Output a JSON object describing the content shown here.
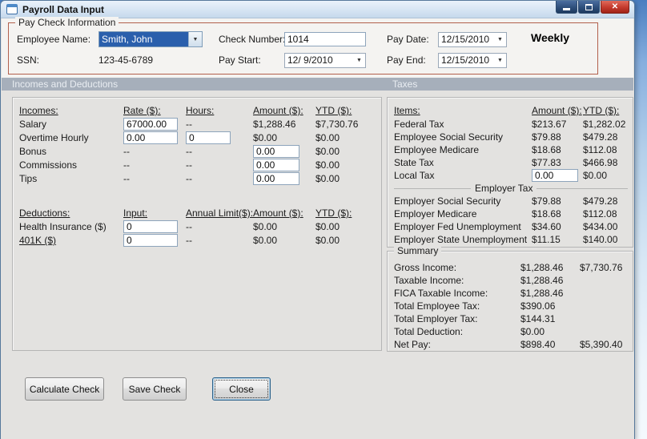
{
  "window": {
    "title": "Payroll Data Input"
  },
  "icons": {
    "close_glyph": "✕",
    "dropdown_glyph": "▼"
  },
  "colors": {
    "group_border": "#b2604d",
    "band_bg": "#a6afbb",
    "selection_bg": "#2a5fac",
    "close_button": "#c43a2d"
  },
  "paycheck": {
    "group_label": "Pay Check Information",
    "employee_name_label": "Employee Name:",
    "employee_name_value": "Smith, John",
    "ssn_label": "SSN:",
    "ssn_value": "123-45-6789",
    "check_number_label": "Check Number:",
    "check_number_value": "1014",
    "pay_start_label": "Pay Start:",
    "pay_start_value": "12/ 9/2010",
    "pay_date_label": "Pay Date:",
    "pay_date_value": "12/15/2010",
    "pay_end_label": "Pay End:",
    "pay_end_value": "12/15/2010",
    "frequency": "Weekly"
  },
  "sections": {
    "left": "Incomes and Deductions",
    "right": "Taxes"
  },
  "incomes": {
    "headers": {
      "c1": "Incomes:",
      "c2": "Rate ($):",
      "c3": "Hours:",
      "c4": "Amount ($):",
      "c5": "YTD ($):"
    },
    "rows": [
      {
        "label": "Salary",
        "rate": "67000.00",
        "hours": "--",
        "amount": "$1,288.46",
        "ytd": "$7,730.76"
      },
      {
        "label": "Overtime Hourly",
        "rate": "0.00",
        "hours": "0",
        "amount": "$0.00",
        "ytd": "$0.00"
      },
      {
        "label": "Bonus",
        "rate": "--",
        "hours": "--",
        "amount": "0.00",
        "ytd": "$0.00"
      },
      {
        "label": "Commissions",
        "rate": "--",
        "hours": "--",
        "amount": "0.00",
        "ytd": "$0.00"
      },
      {
        "label": "Tips",
        "rate": "--",
        "hours": "--",
        "amount": "0.00",
        "ytd": "$0.00"
      }
    ]
  },
  "deductions": {
    "headers": {
      "c1": "Deductions:",
      "c2": "Input:",
      "c3": "Annual Limit($):",
      "c4": "Amount ($):",
      "c5": "YTD ($):"
    },
    "rows": [
      {
        "label": "Health Insurance ($)",
        "input": "0",
        "limit": "--",
        "amount": "$0.00",
        "ytd": "$0.00"
      },
      {
        "label": "401K ($)",
        "input": "0",
        "limit": "--",
        "amount": "$0.00",
        "ytd": "$0.00"
      }
    ]
  },
  "taxes": {
    "headers": {
      "items": "Items:",
      "amount": "Amount ($):",
      "ytd": "YTD ($):"
    },
    "employee_rows": [
      {
        "label": "Federal Tax",
        "amount": "$213.67",
        "ytd": "$1,282.02"
      },
      {
        "label": "Employee Social Security",
        "amount": "$79.88",
        "ytd": "$479.28"
      },
      {
        "label": "Employee Medicare",
        "amount": "$18.68",
        "ytd": "$112.08"
      },
      {
        "label": "State Tax",
        "amount": "$77.83",
        "ytd": "$466.98"
      },
      {
        "label": "Local Tax",
        "amount": "0.00",
        "ytd": "$0.00"
      }
    ],
    "employer_header": "Employer Tax",
    "employer_rows": [
      {
        "label": "Employer Social Security",
        "amount": "$79.88",
        "ytd": "$479.28"
      },
      {
        "label": "Employer Medicare",
        "amount": "$18.68",
        "ytd": "$112.08"
      },
      {
        "label": "Employer Fed Unemployment",
        "amount": "$34.60",
        "ytd": "$434.00"
      },
      {
        "label": "Employer State Unemployment",
        "amount": "$11.15",
        "ytd": "$140.00"
      }
    ]
  },
  "summary": {
    "group_label": "Summary",
    "rows": [
      {
        "label": "Gross Income:",
        "amount": "$1,288.46",
        "ytd": "$7,730.76"
      },
      {
        "label": "Taxable Income:",
        "amount": "$1,288.46",
        "ytd": ""
      },
      {
        "label": "FICA Taxable Income:",
        "amount": "$1,288.46",
        "ytd": ""
      },
      {
        "label": "Total Employee Tax:",
        "amount": "$390.06",
        "ytd": ""
      },
      {
        "label": "Total Employer Tax:",
        "amount": "$144.31",
        "ytd": ""
      },
      {
        "label": "Total Deduction:",
        "amount": "$0.00",
        "ytd": ""
      },
      {
        "label": "Net Pay:",
        "amount": "$898.40",
        "ytd": "$5,390.40"
      }
    ]
  },
  "buttons": {
    "calculate": "Calculate Check",
    "save": "Save Check",
    "close": "Close"
  }
}
